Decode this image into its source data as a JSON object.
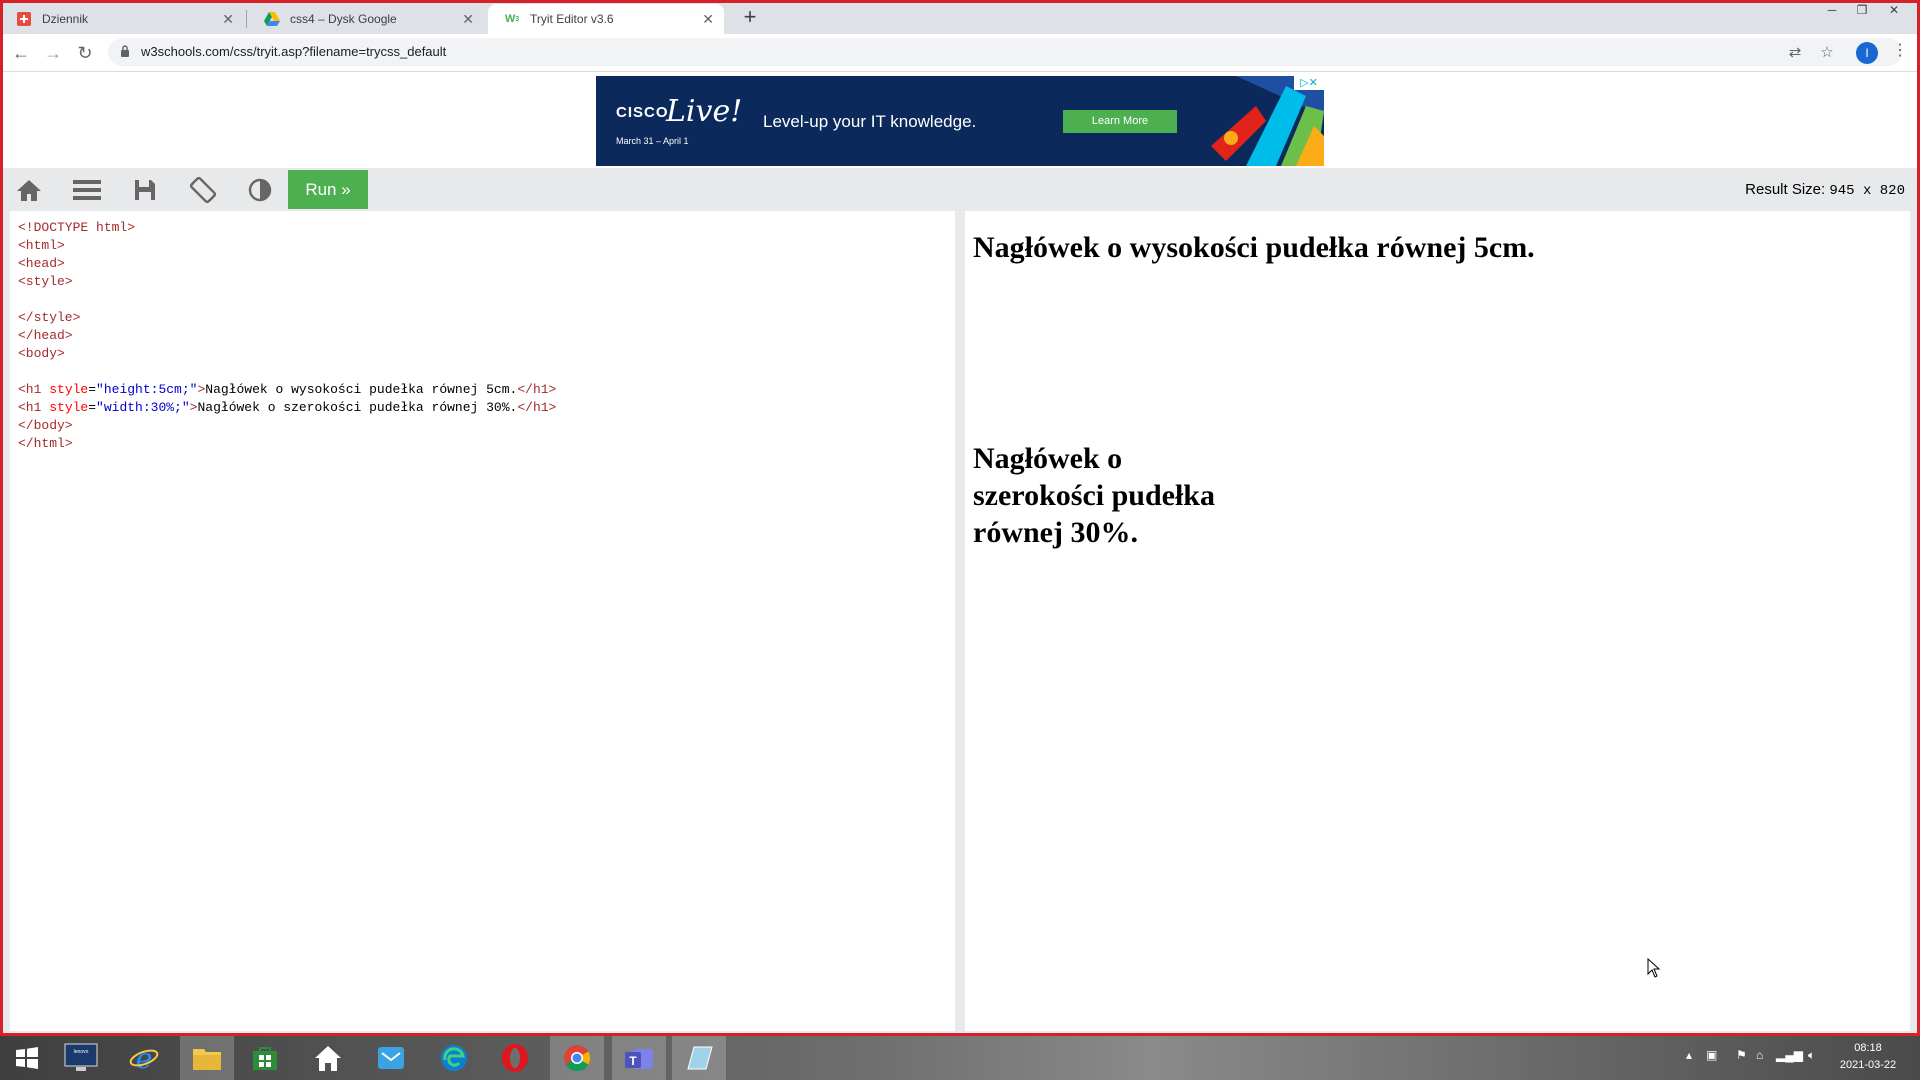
{
  "browser": {
    "tabs": [
      {
        "title": "Dziennik",
        "icon": "dziennik-icon",
        "active": false
      },
      {
        "title": "css4 – Dysk Google",
        "icon": "google-drive-icon",
        "active": false
      },
      {
        "title": "Tryit Editor v3.6",
        "icon": "w3schools-icon",
        "active": true
      }
    ],
    "new_tab": "+",
    "url": "w3schools.com/css/tryit.asp?filename=trycss_default",
    "profile_initial": "I"
  },
  "ad": {
    "brand": "CISCO",
    "brand_script": "Live!",
    "dates": "March 31 – April 1",
    "tagline": "Level-up your IT knowledge.",
    "cta": "Learn More"
  },
  "editor": {
    "run_label": "Run »",
    "result_size_label": "Result Size:",
    "result_size_value": "945 x 820",
    "tool_icons": [
      "home-icon",
      "menu-icon",
      "save-icon",
      "rotate-orientation-icon",
      "contrast-icon"
    ]
  },
  "code": {
    "doctype": "<!DOCTYPE html>",
    "html_open": "<html>",
    "head_open": "<head>",
    "style_open": "<style>",
    "style_close": "</style>",
    "head_close": "</head>",
    "body_open": "<body>",
    "line1_tag": "<h1",
    "line1_attr": "style",
    "line1_value": "\"height:5cm;\"",
    "line1_text": "Nagłówek o wysokości pudełka równej 5cm.",
    "line1_close": "</h1>",
    "line2_tag": "<h1",
    "line2_attr": "style",
    "line2_value": "\"width:30%;\"",
    "line2_text": "Nagłówek o szerokości pudełka równej 30%.",
    "line2_close": "</h1>",
    "body_close": "</body>",
    "html_close": "</html>"
  },
  "result": {
    "heading1": "Nagłówek o wysokości pudełka równej 5cm.",
    "heading2": "Nagłówek o szerokości pudełka równej 30%."
  },
  "taskbar": {
    "apps": [
      "start-icon",
      "lenovo-icon",
      "internet-explorer-icon",
      "file-explorer-icon",
      "store-icon",
      "home-icon",
      "mail-icon",
      "edge-icon",
      "opera-icon",
      "chrome-icon",
      "teams-icon",
      "notes-icon"
    ],
    "time": "08:18",
    "date": "2021-03-22"
  },
  "colors": {
    "window_border": "#d4212a",
    "run_button": "#4caf50",
    "tag": "#a52a2a",
    "attribute": "#ff0000",
    "attr_value": "#0000cd"
  }
}
